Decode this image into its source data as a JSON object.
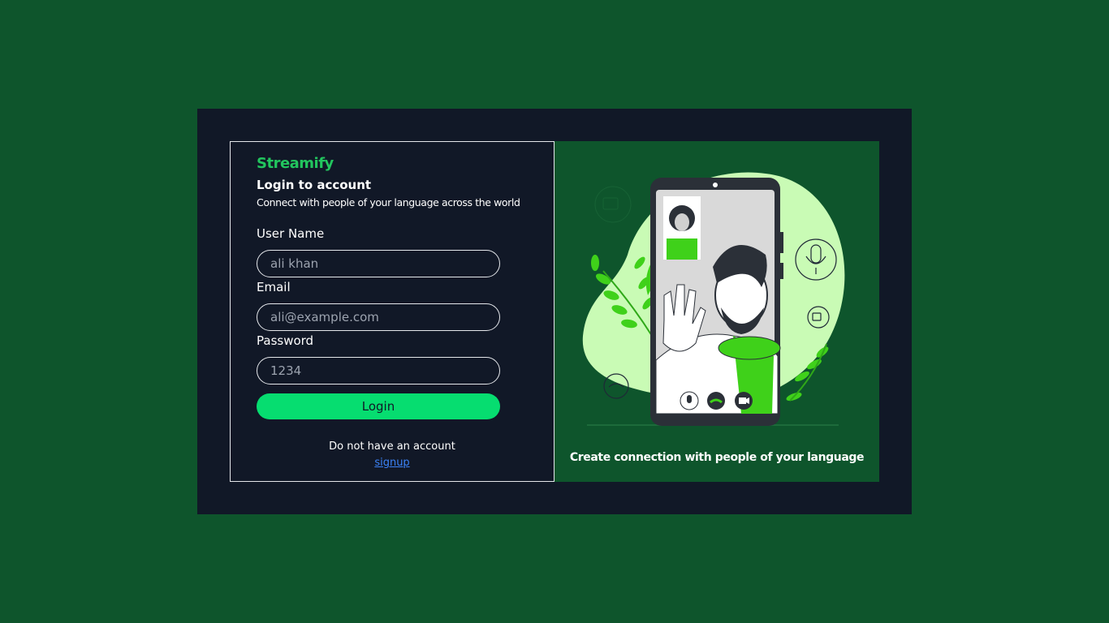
{
  "brand": "Streamify",
  "login": {
    "title": "Login to account",
    "subtitle": "Connect with people of your language across the world",
    "username_label": "User Name",
    "username_placeholder": "ali khan",
    "email_label": "Email",
    "email_placeholder": "ali@example.com",
    "password_label": "Password",
    "password_placeholder": "1234",
    "button_label": "Login",
    "no_account_text": "Do not have an account",
    "signup_link": "signup"
  },
  "promo": {
    "caption": "Create connection with people of your language",
    "illustration_icon": "video-call-illustration"
  },
  "colors": {
    "page_background": "#0e552c",
    "card_background": "#111827",
    "accent": "#06dd70",
    "brand": "#22c55e",
    "link": "#3b82f6",
    "blob": "#c9fbb5",
    "scarf": "#3fd11a"
  }
}
